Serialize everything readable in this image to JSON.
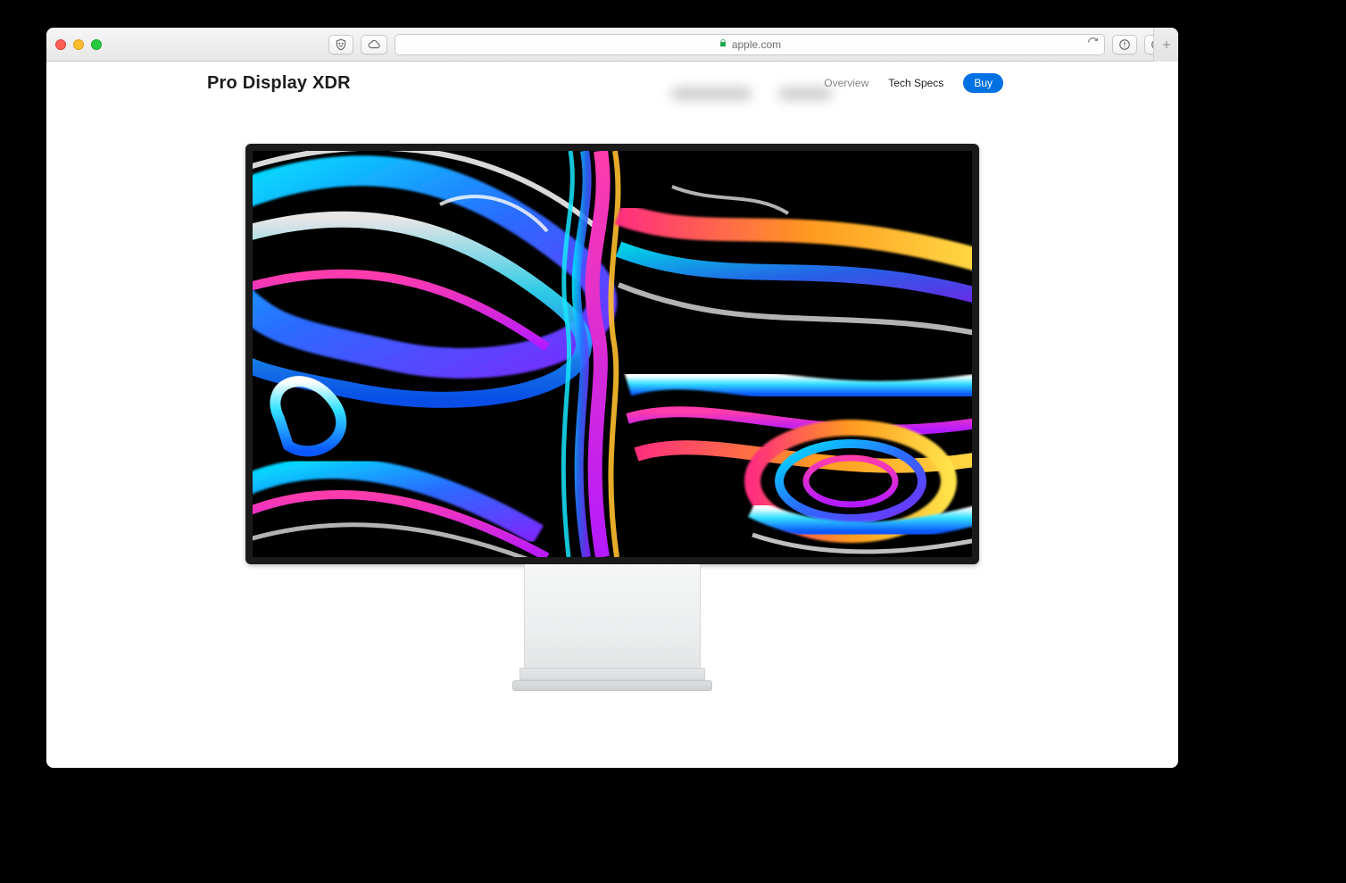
{
  "browser": {
    "url_display": "apple.com",
    "url_secure": true
  },
  "page": {
    "product_title": "Pro Display XDR",
    "nav": {
      "overview": "Overview",
      "techspecs": "Tech Specs",
      "buy": "Buy"
    }
  }
}
